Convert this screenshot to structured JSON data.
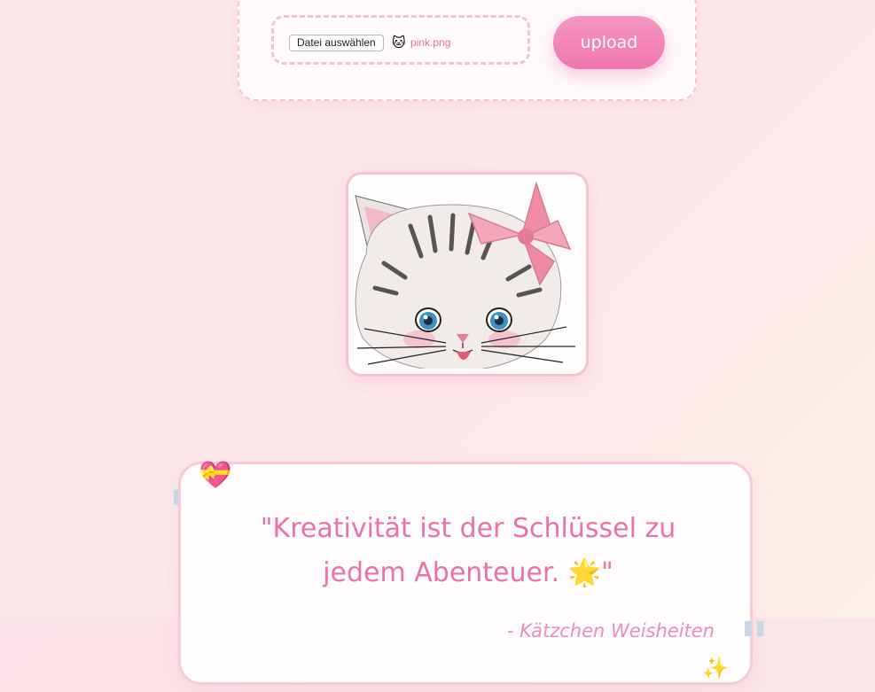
{
  "upload": {
    "choose_file_label": "Datei auswählen",
    "file_icon": "🐱",
    "file_icon_name": "cat-face-icon",
    "file_name": "pink.png",
    "upload_label": "upload"
  },
  "image": {
    "subject": "vintage kitten illustration with pink bow"
  },
  "quote": {
    "text": "\"Kreativität ist der Schlüssel zu jedem Abenteuer. 🌟\"",
    "author": "- Kätzchen Weisheiten",
    "heart_icon": "💝",
    "sparkle_icon": "✨",
    "open_mark": "\"",
    "close_mark": "\""
  },
  "colors": {
    "accent_pink": "#ef76ad",
    "text_pink": "#ea72ad",
    "border_pink": "#f8c9d6",
    "quote_mark_blue": "#c8d7ec"
  }
}
